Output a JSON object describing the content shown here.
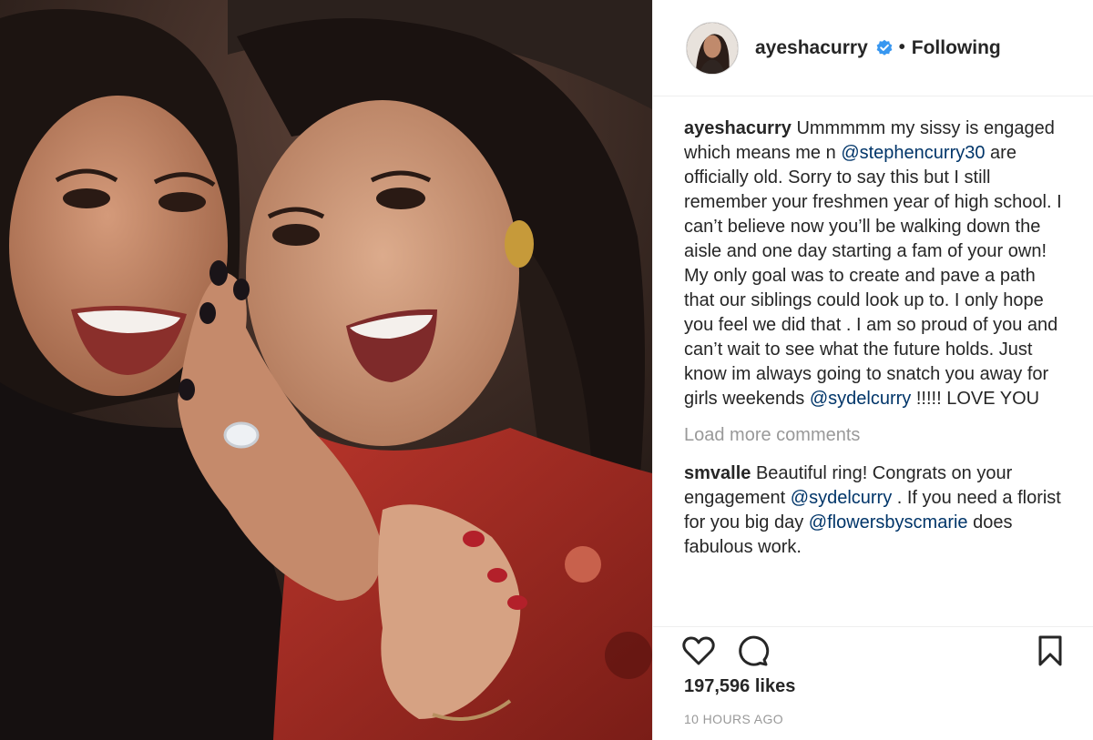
{
  "post": {
    "author": "ayeshacurry",
    "verified": true,
    "separator": "•",
    "follow_state": "Following",
    "caption": {
      "user": "ayeshacurry",
      "text_1": "Ummmmm my sissy is engaged which means me n",
      "mention_1": "@stephencurry30",
      "text_2": "are officially old. Sorry to say this but I still remember your freshmen year of high school. I can’t believe now you’ll be walking down the aisle and one day starting a fam of your own! My only goal was to create and pave a path that our siblings could look up to. I only hope you feel we did that . I am so proud of you and can’t wait to see what the future holds. Just know im always going to snatch you away for girls weekends",
      "mention_2": "@sydelcurry",
      "text_3": "!!!!! LOVE YOU"
    },
    "load_more": "Load more comments",
    "comment": {
      "user": "smvalle",
      "text_1": "Beautiful ring! Congrats on your engagement",
      "mention_1": "@sydelcurry",
      "text_2": ". If you need a florist for you big day",
      "mention_2": "@flowersbyscmarie",
      "text_3": "does fabulous work."
    },
    "likes": "197,596 likes",
    "timestamp": "10 HOURS AGO"
  },
  "icons": {
    "like": "heart-icon",
    "comment": "comment-bubble-icon",
    "save": "bookmark-icon",
    "verified": "verified-badge-icon"
  },
  "colors": {
    "mention": "#003569",
    "muted": "#999999",
    "verified": "#3897f0",
    "text": "#262626"
  }
}
